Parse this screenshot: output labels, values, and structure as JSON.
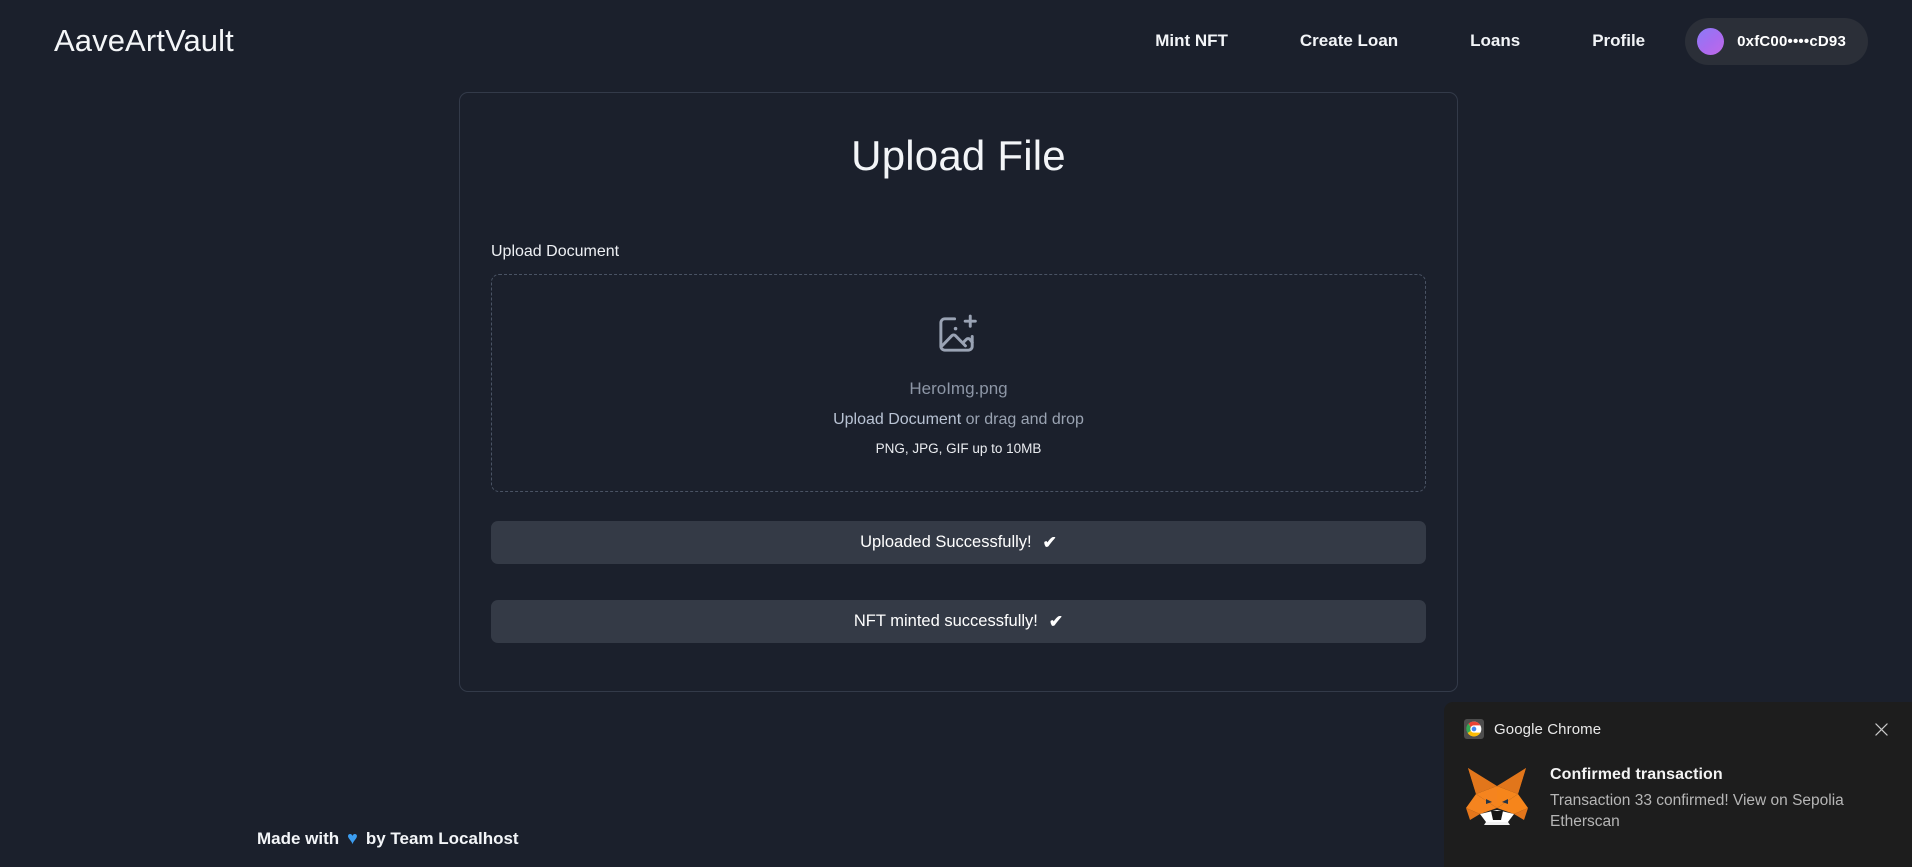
{
  "header": {
    "brand": "AaveArtVault",
    "nav": [
      {
        "label": "Mint NFT",
        "name": "nav-mint-nft"
      },
      {
        "label": "Create Loan",
        "name": "nav-create-loan"
      },
      {
        "label": "Loans",
        "name": "nav-loans"
      },
      {
        "label": "Profile",
        "name": "nav-profile"
      }
    ],
    "wallet": {
      "address": "0xfC00••••cD93",
      "avatar_icon": "wallet-avatar-circle",
      "avatar_color": "#a96bf0"
    }
  },
  "card": {
    "title": "Upload File",
    "field_label": "Upload Document",
    "dropzone": {
      "icon": "image-plus-icon",
      "filename": "HeroImg.png",
      "action_link": "Upload Document",
      "action_rest": " or drag and drop",
      "hint": "PNG, JPG, GIF up to 10MB"
    },
    "status_buttons": [
      {
        "label": "Uploaded Successfully!",
        "check": "✔",
        "name": "upload-status-button"
      },
      {
        "label": "NFT minted successfully!",
        "check": "✔",
        "name": "mint-status-button"
      }
    ]
  },
  "footer": {
    "prefix": "Made with",
    "heart": "♥",
    "suffix": "by Team Localhost"
  },
  "toast": {
    "app_icon": "chrome-icon",
    "app_name": "Google Chrome",
    "close_icon": "close-icon",
    "sender_icon": "metamask-fox-icon",
    "title": "Confirmed transaction",
    "message": "Transaction 33 confirmed! View on Sepolia Etherscan"
  },
  "colors": {
    "page_bg": "#1b202c",
    "card_border": "#333a49",
    "dropzone_border": "#4a5364",
    "status_btn_bg": "#343a46",
    "toast_bg": "#1d1d1d",
    "accent_purple": "#a96bf0",
    "heart_blue": "#3c9df0",
    "fox_orange": "#f5841f"
  }
}
